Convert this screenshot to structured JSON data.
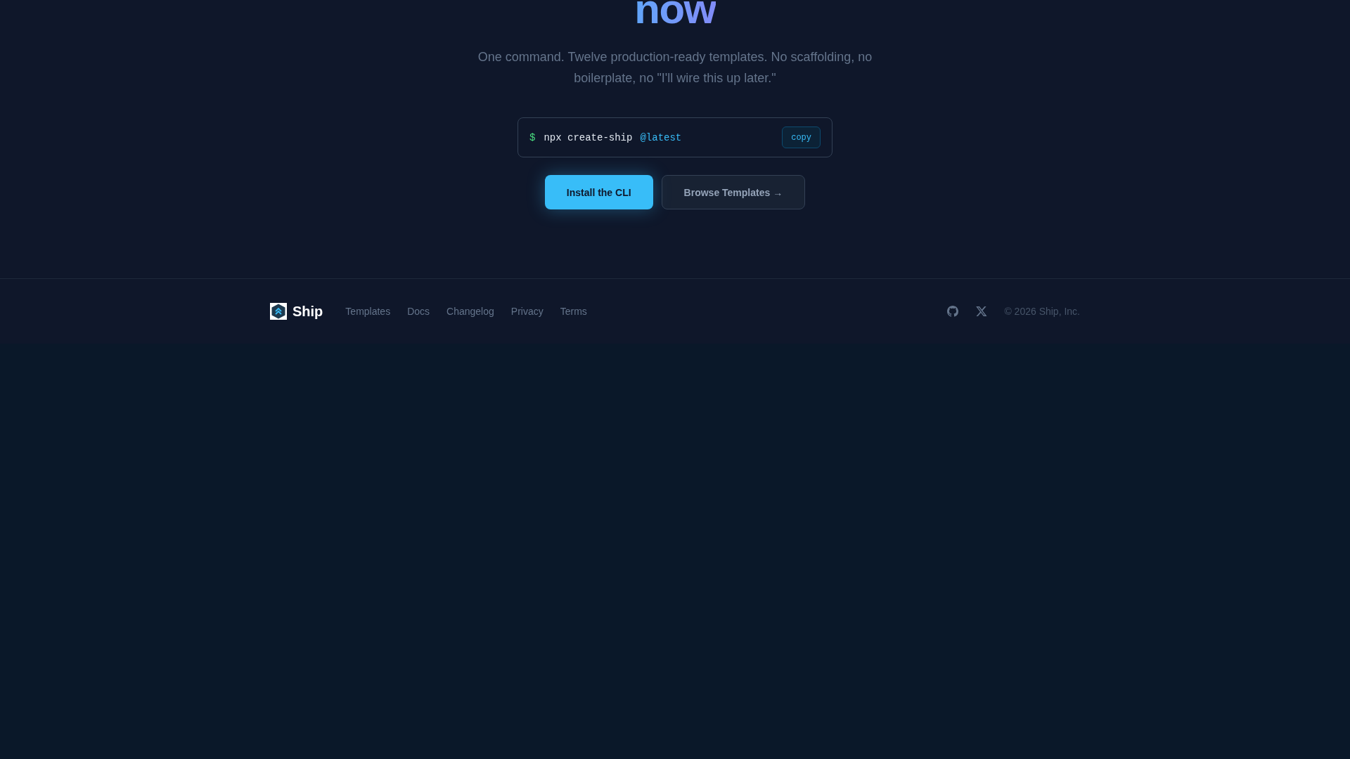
{
  "hero": {
    "heading": "now",
    "subtitle": "One command. Twelve production-ready templates. No scaffolding, no boilerplate, no \"I'll wire this up later.\"",
    "command": {
      "prompt": "$",
      "text": "npx create-ship",
      "tag": "@latest",
      "copy_button": "copy"
    },
    "buttons": [
      {
        "label": "Install the CLI",
        "kind": "primary"
      },
      {
        "label": "Browse Templates →",
        "kind": "secondary"
      }
    ]
  },
  "footer": {
    "brand": "Ship",
    "links": [
      "Templates",
      "Docs",
      "Changelog",
      "Privacy",
      "Terms"
    ],
    "copyright": "© 2026 Ship, Inc."
  }
}
